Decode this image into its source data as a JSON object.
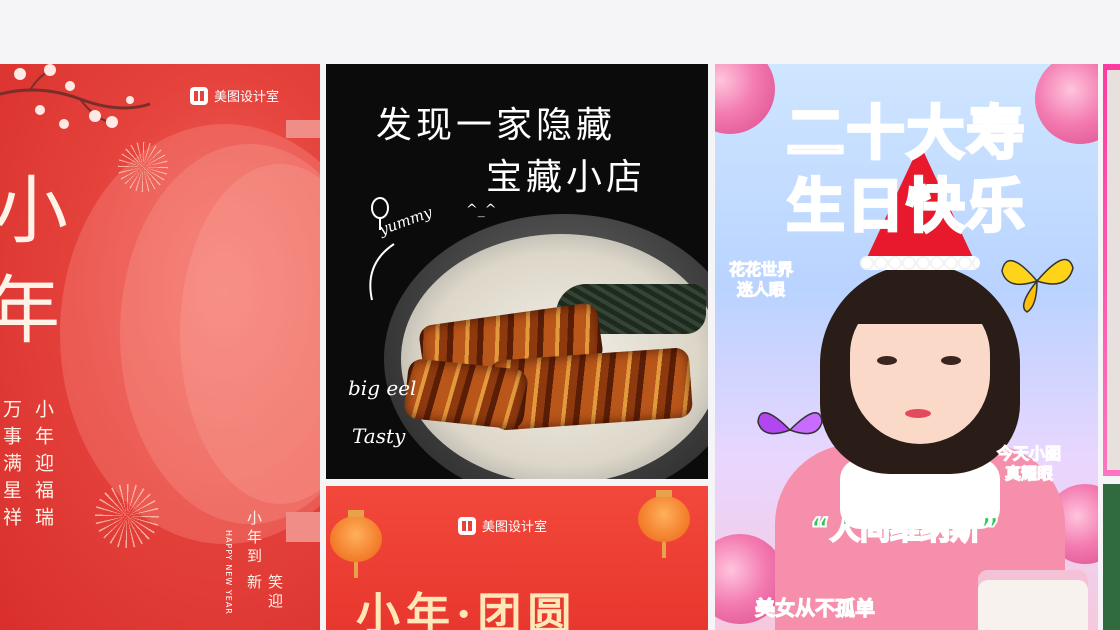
{
  "brand": {
    "name": "美图设计室"
  },
  "card_red_new_year": {
    "title_chars": [
      "小",
      "年"
    ],
    "verse_left": "万事满星祥",
    "verse_right": "小年迎福瑞",
    "footer_vertical_1": "小年到",
    "footer_vertical_2": "笑迎新",
    "footer_english": "HAPPY NEW YEAR"
  },
  "card_eel_rice": {
    "headline_1": "发现一家隐藏",
    "headline_2": "宝藏小店",
    "note_yummy": "yummy",
    "note_smile": "^_^",
    "note_big_eel": "big eel",
    "note_tasty": "Tasty"
  },
  "card_reunion": {
    "title": "小年·团圆"
  },
  "card_birthday": {
    "title_1": "二十大寿",
    "title_2": "生日快乐",
    "sticker_left": "花花世界\n迷人眼",
    "sticker_right": "今天小图\n真耀眼",
    "banner": "“人间维纳斯”",
    "bottom": "美女从不孤单"
  }
}
